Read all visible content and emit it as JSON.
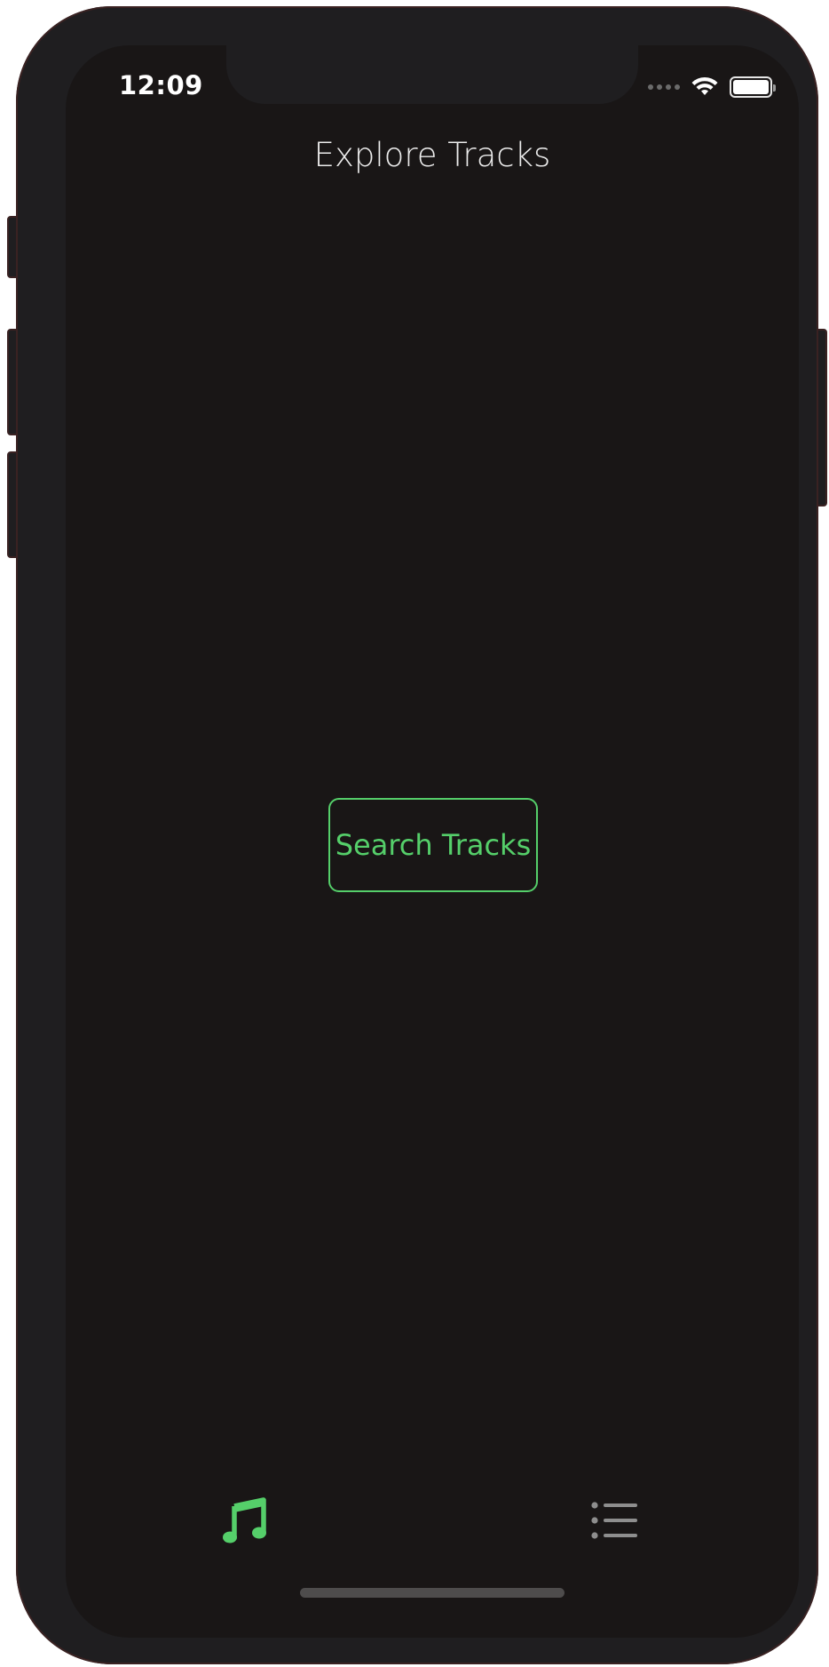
{
  "status_bar": {
    "time": "12:09",
    "icons": [
      "signal-dots-icon",
      "wifi-icon",
      "battery-icon"
    ]
  },
  "header": {
    "title": "Explore Tracks"
  },
  "main": {
    "search_button_label": "Search Tracks"
  },
  "tab_bar": {
    "tabs": [
      {
        "icon": "music-note-icon",
        "selected": true
      },
      {
        "icon": "list-icon",
        "selected": false
      }
    ]
  },
  "colors": {
    "background": "#191616",
    "accent": "#55cf6a",
    "inactive_tab": "#8e8e8e",
    "title_text": "#ececec"
  }
}
